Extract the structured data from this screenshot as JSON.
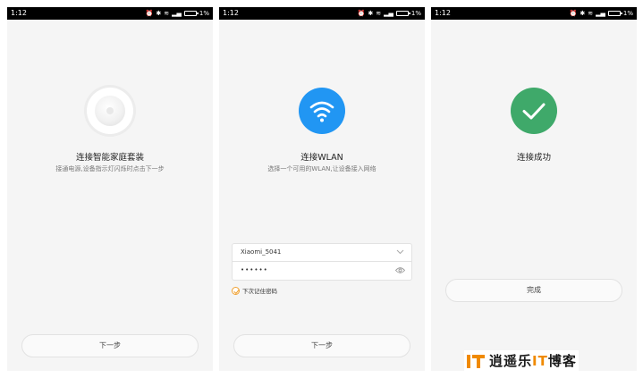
{
  "status_bar": {
    "time": "1:12",
    "battery": "1%"
  },
  "screen1": {
    "title": "连接智能家庭套装",
    "subtitle": "接通电源,设备指示灯闪烁时点击下一步",
    "next_label": "下一步"
  },
  "screen2": {
    "title": "连接WLAN",
    "subtitle": "选择一个可用的WLAN,让设备接入网络",
    "ssid_value": "Xiaomi_5041",
    "password_value": "••••••",
    "remember_label": "下次记住密码",
    "next_label": "下一步"
  },
  "screen3": {
    "title": "连接成功",
    "done_label": "完成"
  },
  "watermark": {
    "prefix": "逍遥乐",
    "accent": "IT",
    "suffix": "博客"
  },
  "colors": {
    "wifi_blue": "#2196f3",
    "success_green": "#3fa96a",
    "accent_orange": "#f08a00"
  }
}
